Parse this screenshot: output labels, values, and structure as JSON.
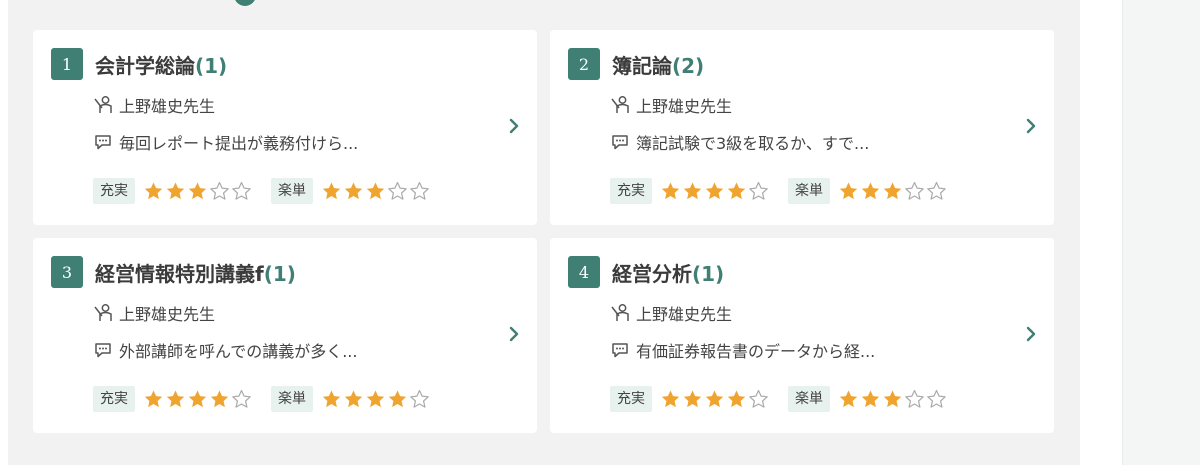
{
  "colors": {
    "accent": "#3f7f74",
    "star": "#f0a430",
    "badge_bg": "#e7f1ee"
  },
  "labels": {
    "fulfill": "充実",
    "easy": "楽単"
  },
  "cards": [
    {
      "rank": "1",
      "title": "会計学総論",
      "count": "(1)",
      "teacher": "上野雄史先生",
      "comment": "毎回レポート提出が義務付けら...",
      "fulfill_rating": 3,
      "easy_rating": 3
    },
    {
      "rank": "2",
      "title": "簿記論",
      "count": "(2)",
      "teacher": "上野雄史先生",
      "comment": "簿記試験で3級を取るか、すで...",
      "fulfill_rating": 4,
      "easy_rating": 3
    },
    {
      "rank": "3",
      "title": "経営情報特別講義f",
      "count": "(1)",
      "teacher": "上野雄史先生",
      "comment": "外部講師を呼んでの講義が多く...",
      "fulfill_rating": 4,
      "easy_rating": 4
    },
    {
      "rank": "4",
      "title": "経営分析",
      "count": "(1)",
      "teacher": "上野雄史先生",
      "comment": "有価証券報告書のデータから経...",
      "fulfill_rating": 4,
      "easy_rating": 3
    }
  ]
}
